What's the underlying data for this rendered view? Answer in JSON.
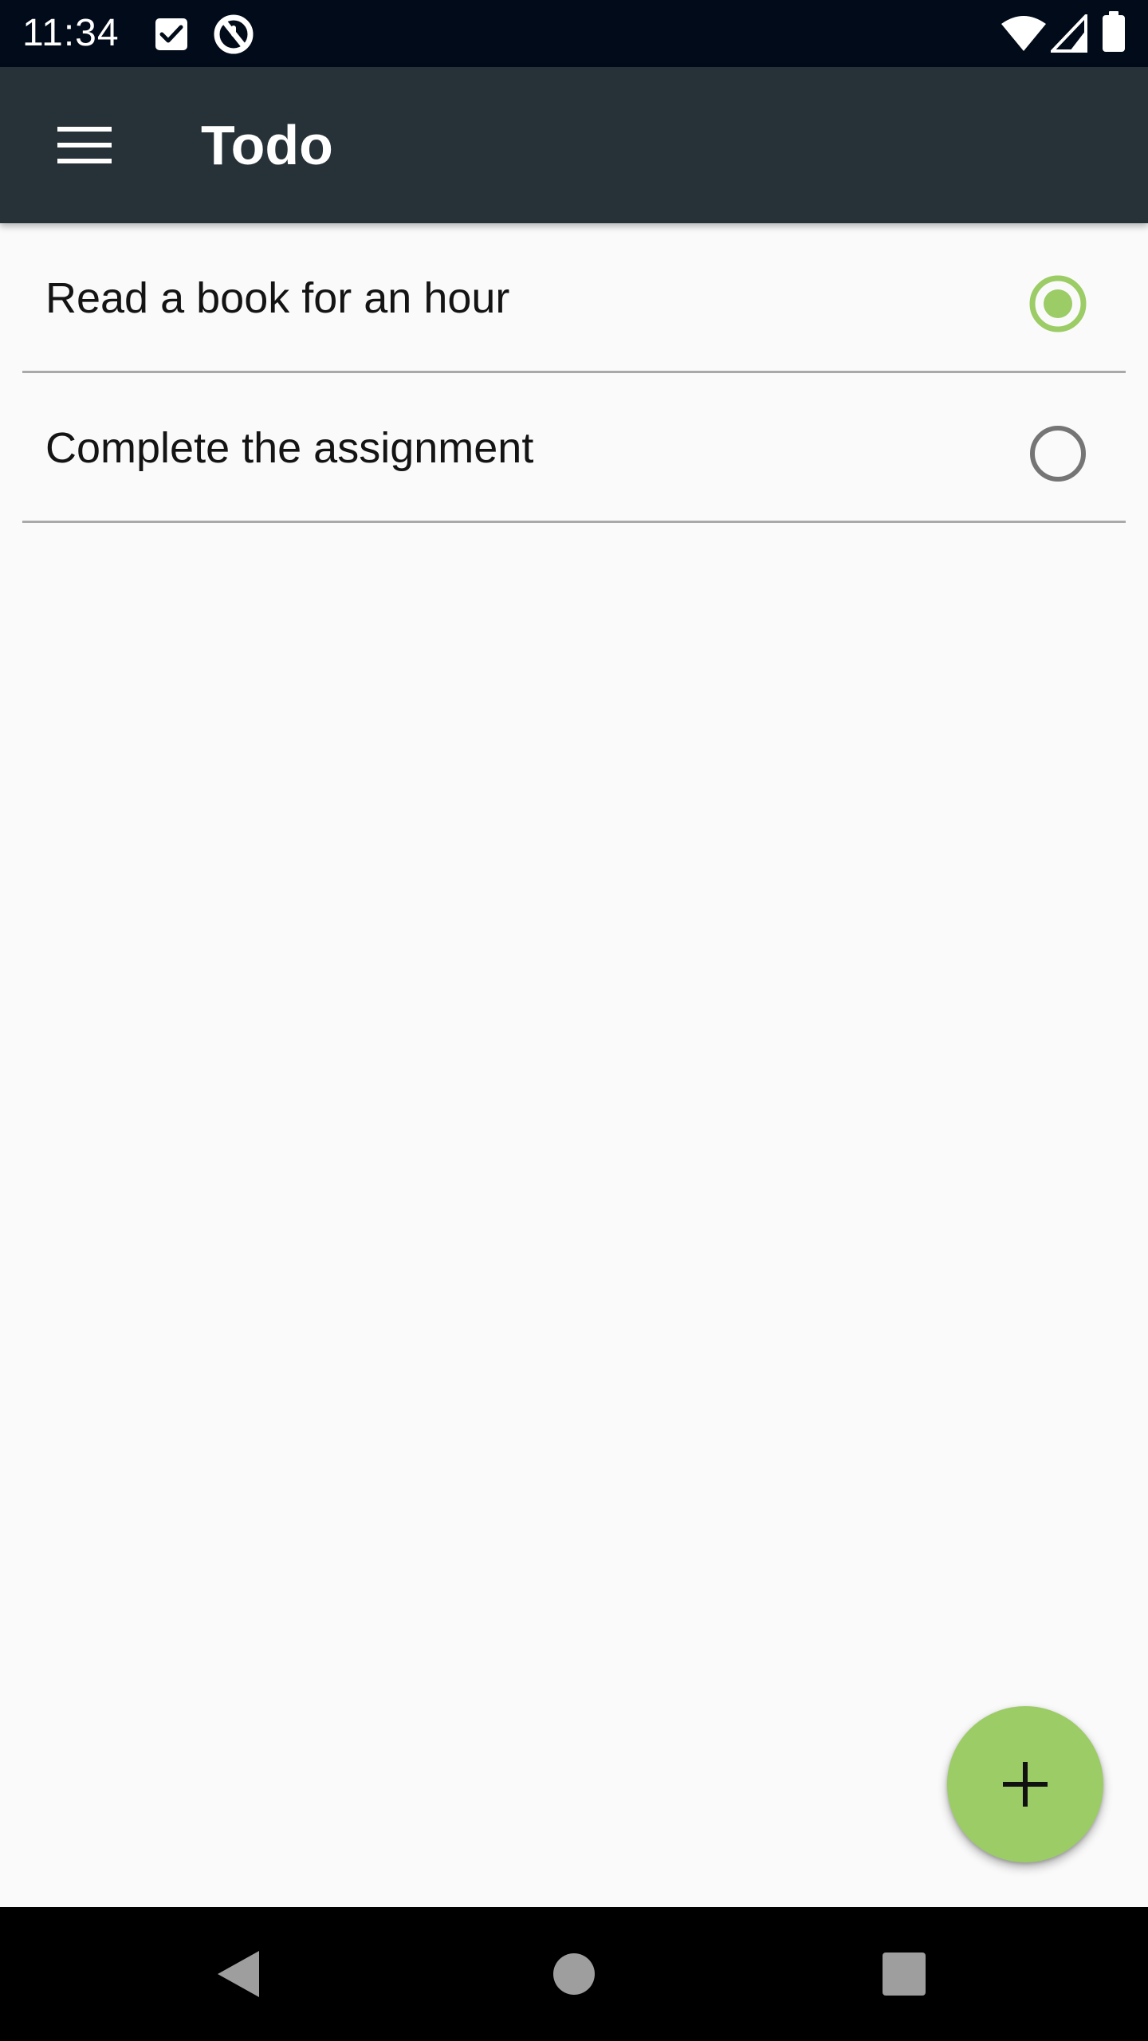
{
  "status_bar": {
    "time": "11:34",
    "icons": [
      "checkbox-notification-icon",
      "data-saver-icon",
      "wifi-icon",
      "signal-icon",
      "battery-icon"
    ]
  },
  "app_bar": {
    "title": "Todo",
    "menu_icon": "hamburger-menu-icon"
  },
  "todos": [
    {
      "text": "Read a book for an hour",
      "selected": true
    },
    {
      "text": "Complete the assignment",
      "selected": false
    }
  ],
  "fab": {
    "icon": "plus-icon"
  },
  "nav_bar": {
    "icons": [
      "back-icon",
      "home-icon",
      "recents-icon"
    ]
  },
  "colors": {
    "status_bar": "#010b19",
    "app_bar": "#263238",
    "accent": "#9ccc65",
    "radio_unselected": "#757575",
    "divider": "#a9a9a9",
    "background": "#fafafa"
  }
}
